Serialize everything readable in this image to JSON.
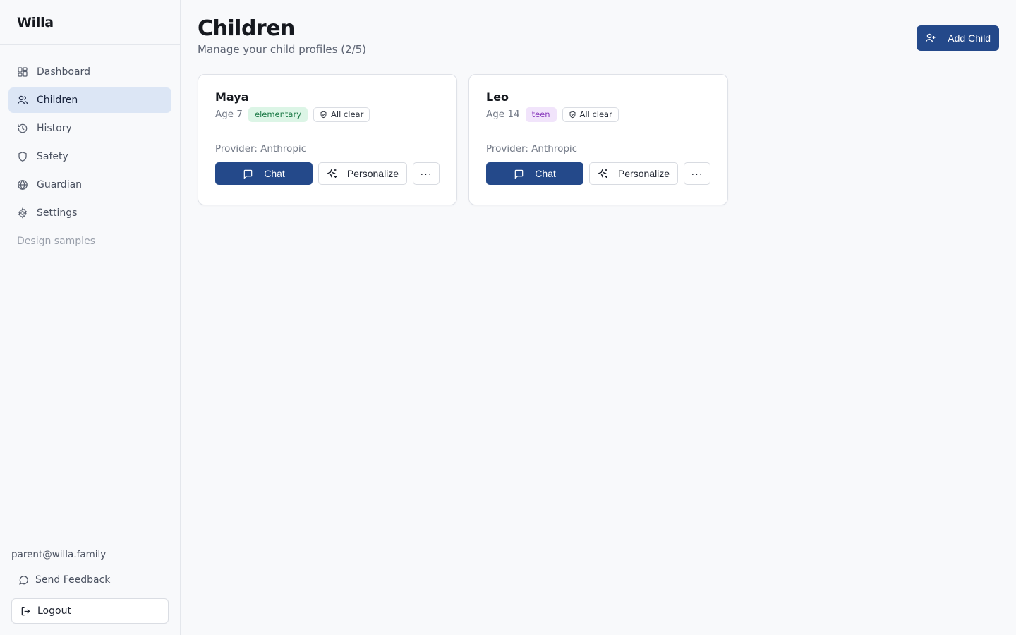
{
  "app": {
    "brand": "Willa"
  },
  "sidebar": {
    "items": [
      {
        "label": "Dashboard",
        "icon": "dashboard-icon",
        "active": false
      },
      {
        "label": "Children",
        "icon": "users-icon",
        "active": true
      },
      {
        "label": "History",
        "icon": "history-icon",
        "active": false
      },
      {
        "label": "Safety",
        "icon": "shield-icon",
        "active": false
      },
      {
        "label": "Guardian",
        "icon": "globe-icon",
        "active": false
      },
      {
        "label": "Settings",
        "icon": "gear-icon",
        "active": false
      }
    ],
    "muted_link": "Design samples",
    "user_email": "parent@willa.family",
    "feedback_label": "Send Feedback",
    "logout_label": "Logout"
  },
  "page": {
    "title": "Children",
    "subtitle": "Manage your child profiles (2/5)",
    "add_button": "Add Child"
  },
  "children": [
    {
      "name": "Maya",
      "age": "Age 7",
      "level": "elementary",
      "level_color": "green",
      "status": "All clear",
      "provider": "Provider: Anthropic",
      "chat_label": "Chat",
      "personalize_label": "Personalize",
      "more_label": "···"
    },
    {
      "name": "Leo",
      "age": "Age 14",
      "level": "teen",
      "level_color": "purple",
      "status": "All clear",
      "provider": "Provider: Anthropic",
      "chat_label": "Chat",
      "personalize_label": "Personalize",
      "more_label": "···"
    }
  ],
  "colors": {
    "primary": "#24498a",
    "active_nav_bg": "#dce6f5",
    "badge_green_bg": "#dcf5e6",
    "badge_purple_bg": "#f1e4fb"
  }
}
